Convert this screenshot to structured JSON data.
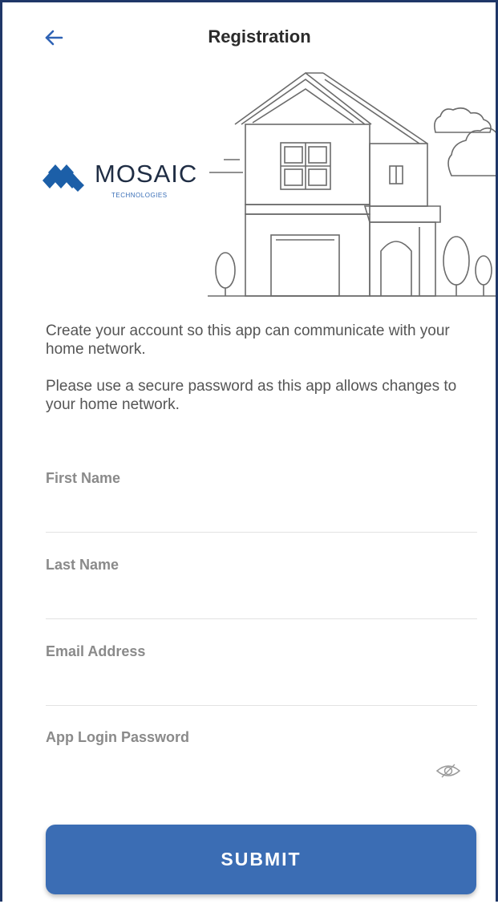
{
  "header": {
    "title": "Registration",
    "back_icon": "arrow-left-icon"
  },
  "logo": {
    "name": "MOSAIC",
    "subtitle": "TECHNOLOGIES"
  },
  "intro": {
    "paragraph1": "Create your account so this app can communicate with your home network.",
    "paragraph2": "Please use a secure password as this app allows changes to your home network."
  },
  "form": {
    "first_name": {
      "label": "First Name",
      "value": ""
    },
    "last_name": {
      "label": "Last Name",
      "value": ""
    },
    "email": {
      "label": "Email Address",
      "value": ""
    },
    "password": {
      "label": "App Login Password",
      "value": "",
      "toggle_icon": "eye-icon"
    }
  },
  "submit": {
    "label": "SUBMIT"
  },
  "colors": {
    "accent": "#3b6db4",
    "frame": "#1f3768",
    "logo_diamonds": "#1c5fa8"
  }
}
